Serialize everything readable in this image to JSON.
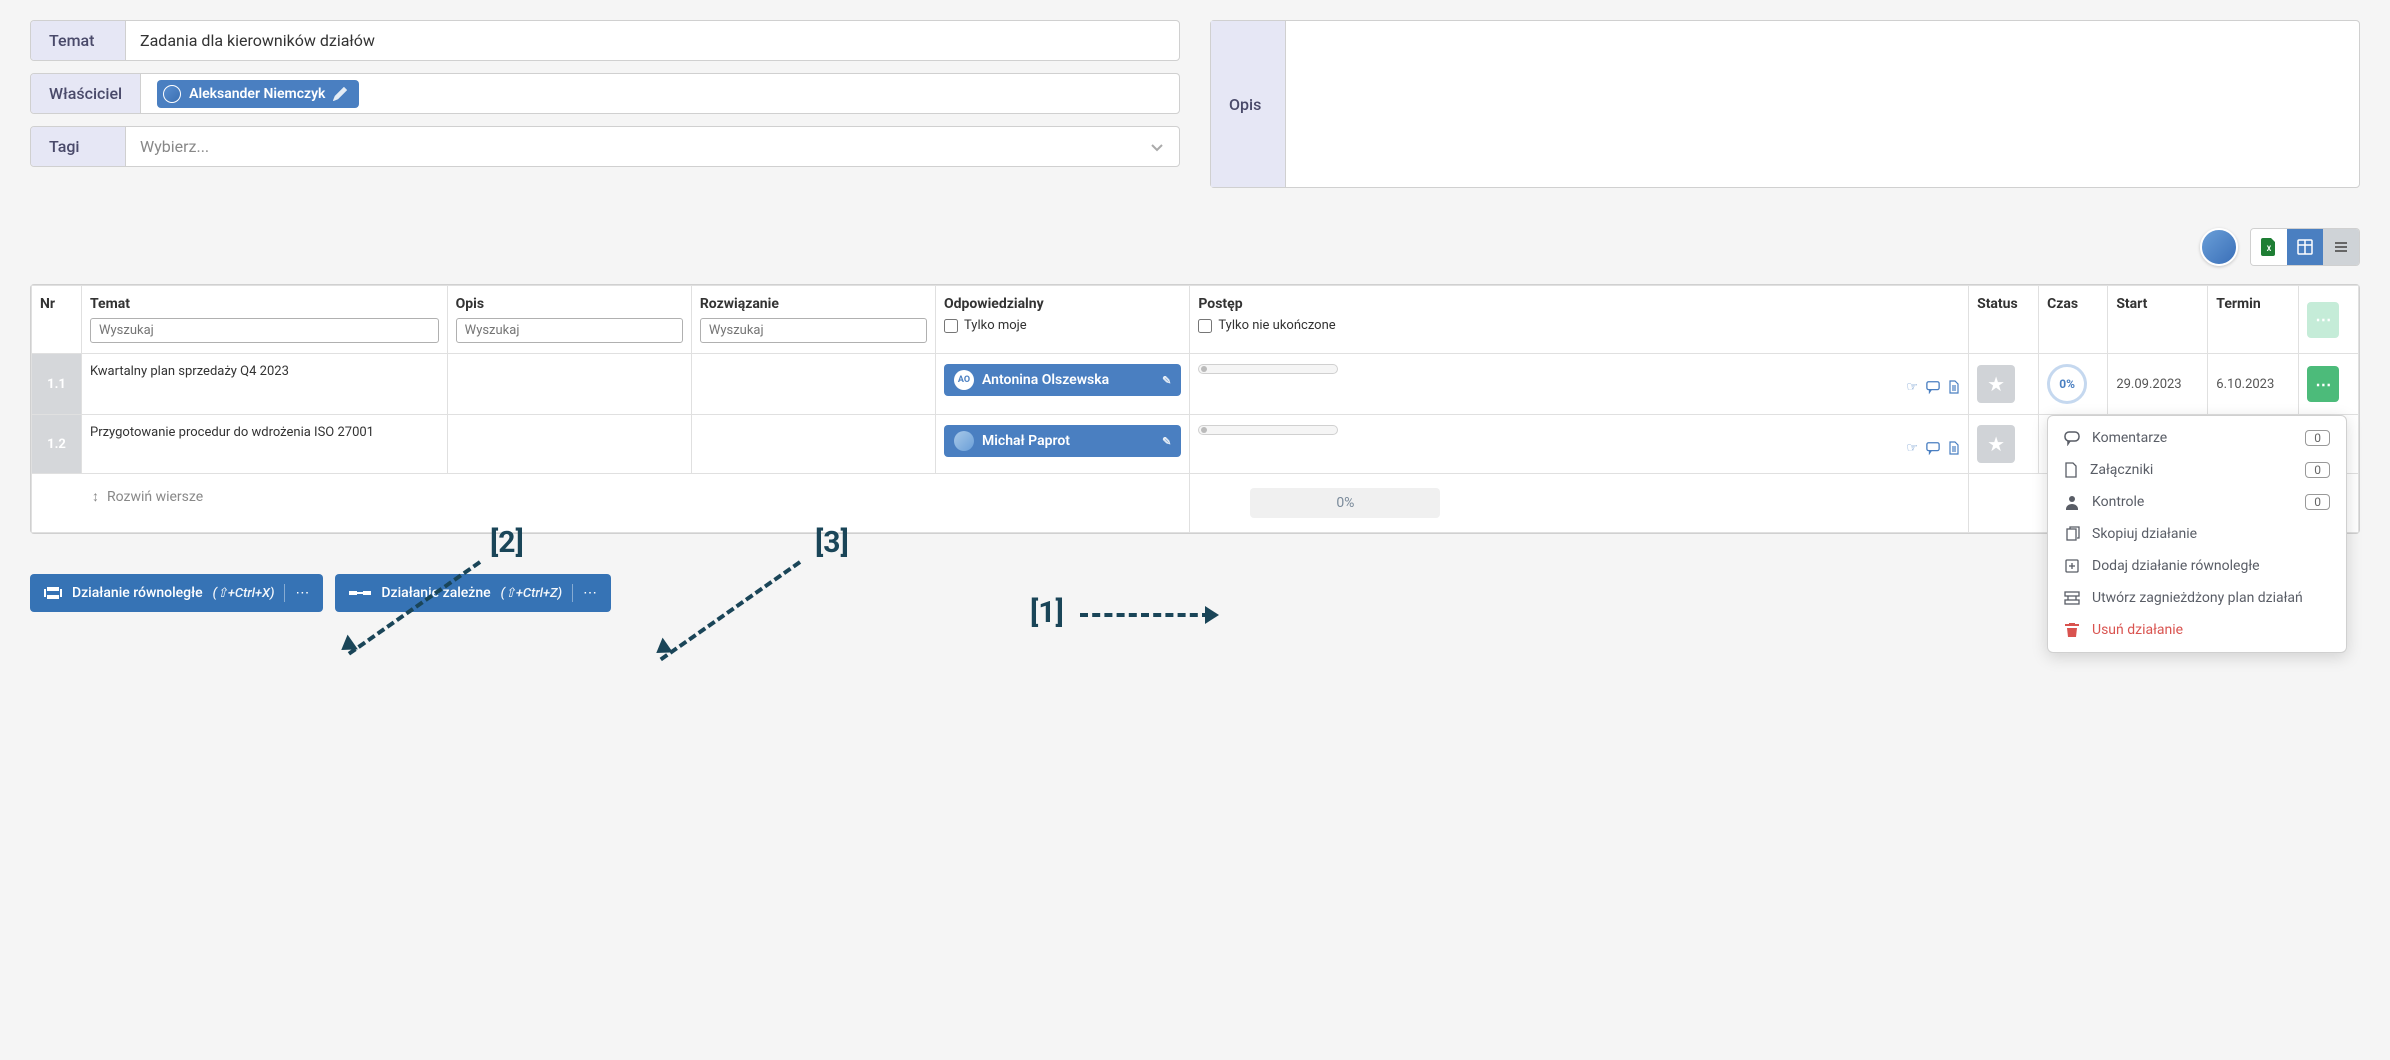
{
  "topic": {
    "label": "Temat",
    "value": "Zadania dla kierowników działów"
  },
  "owner": {
    "label": "Właściciel",
    "chip_name": "Aleksander Niemczyk"
  },
  "tags": {
    "label": "Tagi",
    "placeholder": "Wybierz..."
  },
  "description": {
    "label": "Opis"
  },
  "table": {
    "headers": {
      "nr": "Nr",
      "topic": "Temat",
      "desc": "Opis",
      "solution": "Rozwiązanie",
      "responsible": "Odpowiedzialny",
      "progress": "Postęp",
      "status": "Status",
      "time": "Czas",
      "start": "Start",
      "deadline": "Termin"
    },
    "search_placeholder": "Wyszukaj",
    "only_mine": "Tylko moje",
    "only_unfinished": "Tylko nie ukończone",
    "rows": [
      {
        "nr": "1.1",
        "topic": "Kwartalny plan sprzedaży Q4 2023",
        "assignee": "Antonina Olszewska",
        "assignee_initials": "AO",
        "time": "0%",
        "start": "29.09.2023",
        "deadline": "6.10.2023"
      },
      {
        "nr": "1.2",
        "topic": "Przygotowanie procedur do wdrożenia ISO 27001",
        "assignee": "Michał Paprot"
      }
    ],
    "expand_rows": "Rozwiń wiersze",
    "footer_progress": "0%"
  },
  "buttons": {
    "parallel": {
      "label": "Działanie równoległe",
      "shortcut": "(⇧+Ctrl+X)"
    },
    "dependent": {
      "label": "Działanie zależne",
      "shortcut": "(⇧+Ctrl+Z)"
    }
  },
  "menu": {
    "comments": "Komentarze",
    "attachments": "Załączniki",
    "controls": "Kontrole",
    "copy": "Skopiuj działanie",
    "add_parallel": "Dodaj działanie równoległe",
    "create_nested": "Utwórz zagnieżdżony plan działań",
    "delete": "Usuń działanie",
    "count0": "0"
  },
  "annotations": {
    "a1": "[1]",
    "a2": "[2]",
    "a3": "[3]"
  }
}
